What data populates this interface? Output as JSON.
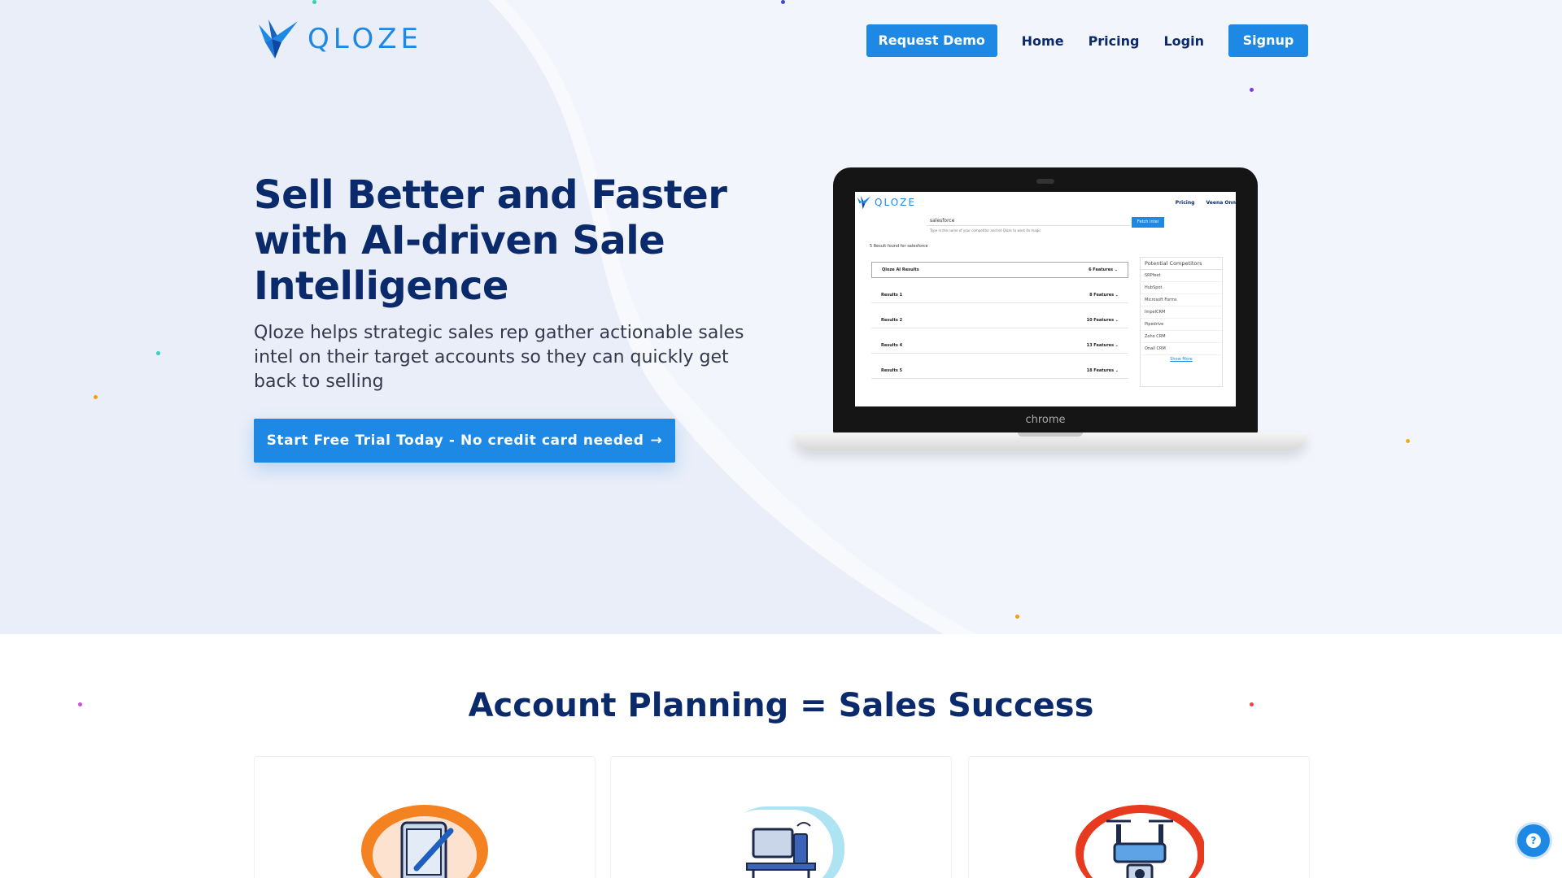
{
  "header": {
    "logo_text": "QLOZE",
    "nav": {
      "request_demo": "Request Demo",
      "home": "Home",
      "pricing": "Pricing",
      "login": "Login",
      "signup": "Signup"
    }
  },
  "hero": {
    "title": "Sell Better and Faster with AI-driven Sale Intelligence",
    "subtitle": "Qloze helps strategic sales rep gather actionable sales intel on their target accounts so they can quickly get back to selling",
    "cta_label": "Start Free Trial Today - No credit card needed",
    "cta_arrow": "→"
  },
  "laptop_screen": {
    "logo_text": "QLOZE",
    "nav": [
      "Pricing",
      "Veena Onn"
    ],
    "search_value": "salesforce",
    "search_hint": "Type in the name of your competitor and let Qloze to work its magic",
    "fetch_button": "Fetch Intel",
    "found_text": "5 Result found for salesforce",
    "results": [
      {
        "name": "Qloze AI Results",
        "features": "6 Features"
      },
      {
        "name": "Results 1",
        "features": "8 Features"
      },
      {
        "name": "Results 2",
        "features": "10 Features"
      },
      {
        "name": "Results 4",
        "features": "13 Features"
      },
      {
        "name": "Results 5",
        "features": "18 Features"
      }
    ],
    "competitors_title": "Potential Competitors",
    "competitors": [
      "SRPfeet",
      "HubSpot",
      "Microsoft Forms",
      "ImpelCRM",
      "Pipedrive",
      "Zoho CRM",
      "Onall CRM"
    ],
    "show_more": "Show More",
    "chrome_label": "chrome"
  },
  "section2": {
    "title": "Account Planning = Sales Success"
  },
  "help_label": "?",
  "colors": {
    "accent": "#1e88e5",
    "heading": "#0b2a6b",
    "hero_bg": "#f2f5fc"
  },
  "icons": [
    "logo-bird-icon",
    "arrow-right-icon",
    "tablet-pen-icon",
    "computer-desk-icon",
    "drone-camera-icon",
    "help-icon"
  ]
}
